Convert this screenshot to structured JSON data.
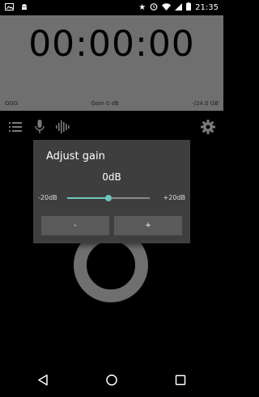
{
  "status_bar": {
    "time": "21:35",
    "left_icons": [
      "image-icon",
      "android-icon"
    ],
    "right_icons": [
      "star-icon",
      "alarm-icon",
      "wifi-icon",
      "signal-icon",
      "battery-icon"
    ]
  },
  "recorder": {
    "timer": "00:00:00",
    "format": "OGG",
    "gain": "Gain 0 dB",
    "level": "-/24.0 GB"
  },
  "toolbar": {
    "icons": [
      "list-icon",
      "mic-icon",
      "waveform-icon",
      "gear-icon"
    ]
  },
  "dialog": {
    "title": "Adjust gain",
    "value": "0dB",
    "min_label": "-20dB",
    "max_label": "+20dB",
    "slider_value_db": 0,
    "slider_min_db": -20,
    "slider_max_db": 20,
    "minus_label": "-",
    "plus_label": "+"
  },
  "colors": {
    "accent": "#6ec5be",
    "panel": "#6f6f6f",
    "dialog": "#3e3e3e"
  },
  "navbar": {
    "icons": [
      "back-icon",
      "home-icon",
      "recents-icon"
    ]
  }
}
